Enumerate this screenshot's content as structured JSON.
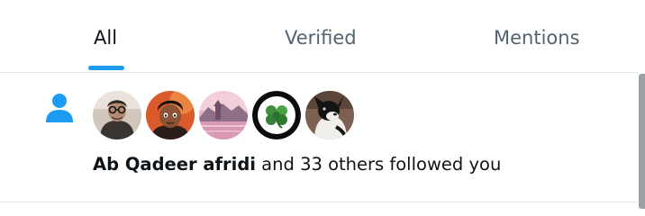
{
  "tabs": [
    {
      "label": "All",
      "selected": true
    },
    {
      "label": "Verified",
      "selected": false
    },
    {
      "label": "Mentions",
      "selected": false
    }
  ],
  "colors": {
    "accent": "#1d9bf0",
    "text_primary": "#0f1419",
    "text_secondary": "#536471",
    "divider": "#e1e6ea"
  },
  "notification": {
    "type_icon": "person-icon",
    "avatars": [
      {
        "icon": "avatar-photo-glasses"
      },
      {
        "icon": "avatar-cartoon-man"
      },
      {
        "icon": "avatar-pink-landscape"
      },
      {
        "icon": "avatar-green-clover"
      },
      {
        "icon": "avatar-black-white-dog"
      }
    ],
    "user_name": "Ab Qadeer afridi",
    "message_rest": " and 33 others followed you"
  }
}
